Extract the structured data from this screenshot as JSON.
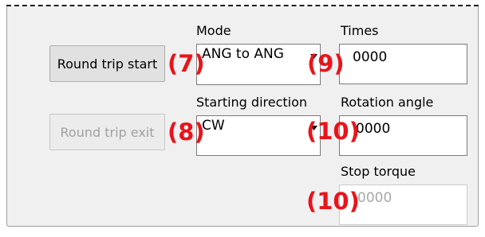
{
  "buttons": {
    "round_trip_start": "Round trip start",
    "round_trip_exit": "Round trip exit"
  },
  "labels": {
    "mode": "Mode",
    "times": "Times",
    "starting_direction": "Starting direction",
    "rotation_angle": "Rotation angle",
    "stop_torque": "Stop torque"
  },
  "fields": {
    "mode_value": "ANG to ANG",
    "times_value": "0000",
    "starting_direction_value": "CW",
    "rotation_angle_value": "0000",
    "stop_torque_value": "0000"
  },
  "callouts": {
    "c7": "(7)",
    "c8": "(8)",
    "c9": "(9)",
    "c10a": "(10)",
    "c10b": "(10)"
  },
  "colors": {
    "callout": "#e8141a",
    "panel_background": "#f0f0f0",
    "disabled_text": "#a0a0a0"
  },
  "icons": {
    "combo_arrow": "chevron-down-icon"
  }
}
